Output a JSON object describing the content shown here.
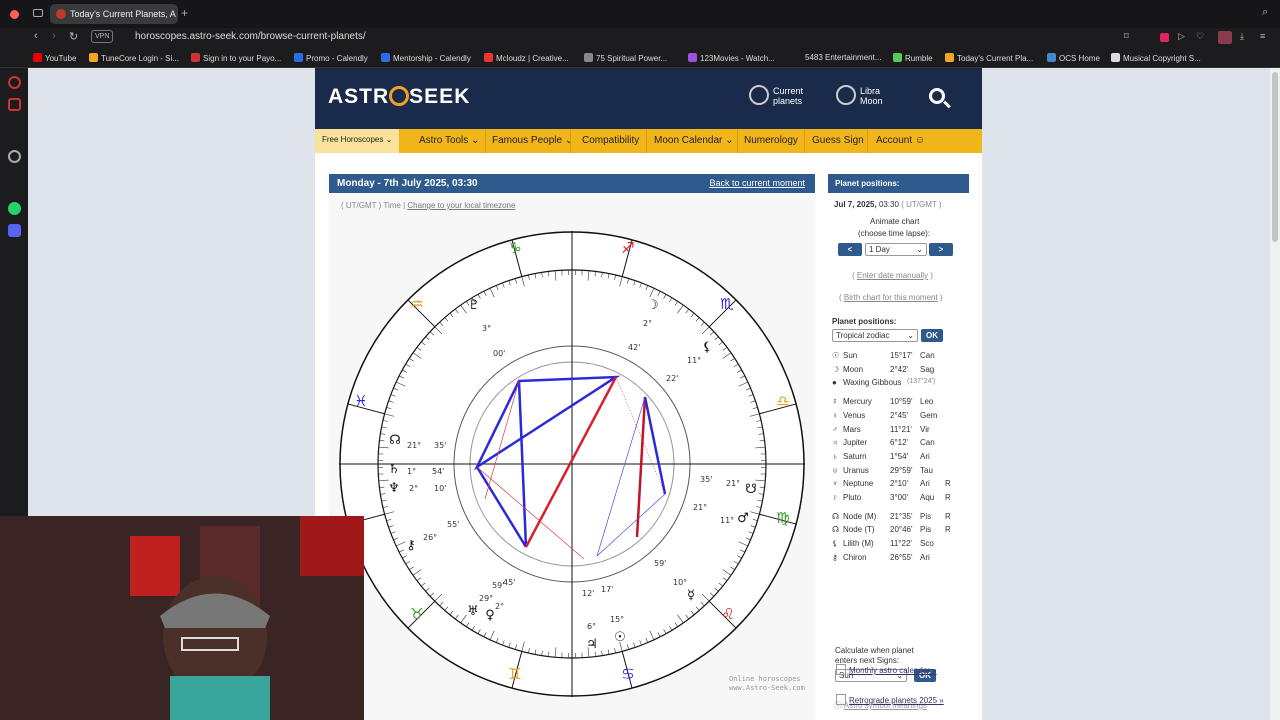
{
  "browser": {
    "tab_title": "Today's Current Planets, A",
    "vpn": "VPN",
    "url": "horoscopes.astro-seek.com/browse-current-planets/"
  },
  "bookmarks": [
    "YouTube",
    "TuneCore Login - Si...",
    "Sign in to your Payo...",
    "Promo - Calendly",
    "Mentorship - Calendly",
    "Mcloudz | Creative...",
    "75 Spiritual Power...",
    "123Movies - Watch...",
    "5483 Entertainment...",
    "Rumble",
    "Today's Current Pla...",
    "OCS Home",
    "Musical Copyright S..."
  ],
  "site": {
    "logo_left": "ASTR",
    "logo_right": "SEEK",
    "current_planets": "Current planets",
    "libra_moon_1": "Libra",
    "libra_moon_2": "Moon",
    "current_1": "Current",
    "current_2": "planets"
  },
  "nav": [
    "Free Horoscopes",
    "Astro Tools",
    "Famous People",
    "Compatibility",
    "Moon Calendar",
    "Numerology",
    "Guess Sign",
    "Account"
  ],
  "chart": {
    "date_title": "Monday - 7th July 2025, 03:30",
    "back_link": "Back to current moment",
    "ut": "( UT/GMT )",
    "time": "Time",
    "tz_link": "Change to your local timezone",
    "credit_1": "Online horoscopes",
    "credit_2": "www.Astro-Seek.com"
  },
  "panel": {
    "title": "Planet positions:",
    "date": "Jul 7, 2025,",
    "time": "03:30",
    "ut": "( UT/GMT )",
    "animate": "Animate chart",
    "lapse": "(choose time lapse):",
    "prev": "<",
    "next": ">",
    "lapse_value": "1 Day",
    "enter_manual": "Enter date manually",
    "birth_chart": "Birth chart for this moment",
    "positions_label": "Planet positions:",
    "zodiac": "Tropical zodiac",
    "ok": "OK",
    "calc_1": "Calculate when planet",
    "calc_2": "enters next Signs:",
    "calc_value": "Sun",
    "meanings": "Astro symbol meanings",
    "monthly": "Monthly astro calendar",
    "retro": "Retrograde planets 2025"
  },
  "planets": [
    {
      "name": "Sun",
      "deg": "15°17'",
      "sign": "Can",
      "r": ""
    },
    {
      "name": "Moon",
      "deg": "2°42'",
      "sign": "Sag",
      "r": ""
    },
    {
      "name": "Waxing Gibbous",
      "deg": "(137°24')",
      "sign": "",
      "r": ""
    },
    {
      "name": "Mercury",
      "deg": "10°59'",
      "sign": "Leo",
      "r": ""
    },
    {
      "name": "Venus",
      "deg": "2°45'",
      "sign": "Gem",
      "r": ""
    },
    {
      "name": "Mars",
      "deg": "11°21'",
      "sign": "Vir",
      "r": ""
    },
    {
      "name": "Jupiter",
      "deg": "6°12'",
      "sign": "Can",
      "r": ""
    },
    {
      "name": "Saturn",
      "deg": "1°54'",
      "sign": "Ari",
      "r": ""
    },
    {
      "name": "Uranus",
      "deg": "29°59'",
      "sign": "Tau",
      "r": ""
    },
    {
      "name": "Neptune",
      "deg": "2°10'",
      "sign": "Ari",
      "r": "R"
    },
    {
      "name": "Pluto",
      "deg": "3°00'",
      "sign": "Aqu",
      "r": "R"
    },
    {
      "name": "Node (M)",
      "deg": "21°35'",
      "sign": "Pis",
      "r": "R"
    },
    {
      "name": "Node (T)",
      "deg": "20°46'",
      "sign": "Pis",
      "r": "R"
    },
    {
      "name": "Lilith (M)",
      "deg": "11°22'",
      "sign": "Sco",
      "r": ""
    },
    {
      "name": "Chiron",
      "deg": "26°55'",
      "sign": "Ari",
      "r": ""
    }
  ],
  "colors": {
    "header": "#1a2a4a",
    "nav": "#f1b51c",
    "accent": "#2f5a8d"
  }
}
